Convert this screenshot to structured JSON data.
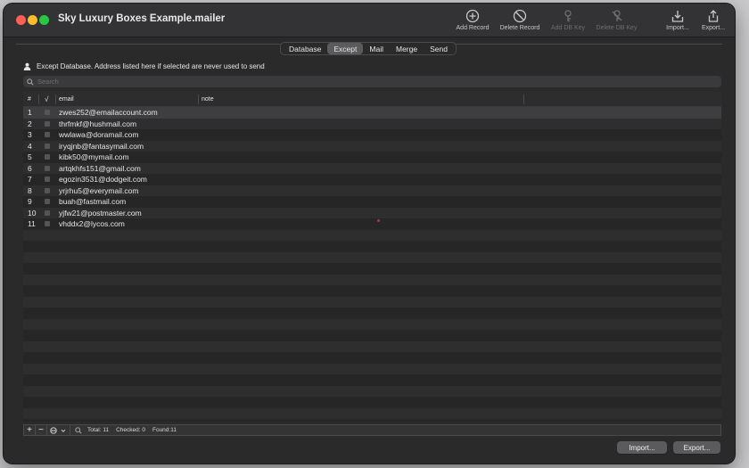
{
  "window": {
    "title": "Sky Luxury Boxes Example.mailer"
  },
  "toolbar": {
    "add_record": "Add Record",
    "delete_record": "Delete Record",
    "add_db_key": "Add DB Key",
    "delete_db_key": "Delete DB Key",
    "import": "Import...",
    "export": "Export..."
  },
  "tabs": [
    "Database",
    "Except",
    "Mail",
    "Merge",
    "Send"
  ],
  "active_tab": "Except",
  "except_description": "Except Database. Address listed here if selected are never used to send",
  "search": {
    "placeholder": "Search"
  },
  "table": {
    "headers": {
      "num": "#",
      "check": "√",
      "email": "email",
      "note": "note"
    },
    "rows": [
      {
        "num": "1",
        "email": "zwes252@emailaccount.com"
      },
      {
        "num": "2",
        "email": "thrfmkf@hushmail.com"
      },
      {
        "num": "3",
        "email": "wwlawa@doramail.com"
      },
      {
        "num": "4",
        "email": "iryqjnb@fantasymail.com"
      },
      {
        "num": "5",
        "email": "kibk50@mymail.com"
      },
      {
        "num": "6",
        "email": "artqkhfs151@gmail.com"
      },
      {
        "num": "7",
        "email": "egozin3531@dodgeit.com"
      },
      {
        "num": "8",
        "email": "yrjrhu5@everymail.com"
      },
      {
        "num": "9",
        "email": "buah@fastmail.com"
      },
      {
        "num": "10",
        "email": "yjfw21@postmaster.com"
      },
      {
        "num": "11",
        "email": "vhddx2@lycos.com"
      }
    ]
  },
  "status": {
    "total": "Total: 11",
    "checked": "Checked: 0",
    "found": "Found:11"
  },
  "buttons": {
    "import": "Import...",
    "export": "Export..."
  },
  "colors": {
    "selected_row": "#3e3e40",
    "active_tab": "#5b5b5d"
  }
}
